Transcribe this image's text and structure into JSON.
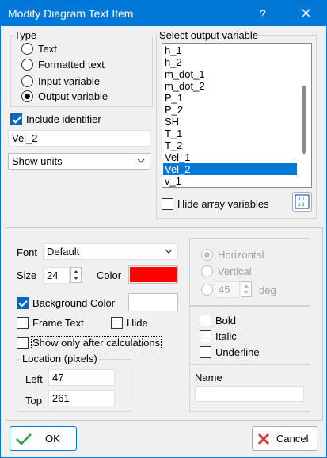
{
  "window": {
    "title": "Modify Diagram Text Item",
    "help_label": "?"
  },
  "type_group": {
    "label": "Type",
    "options": [
      {
        "label": "Text",
        "selected": false
      },
      {
        "label": "Formatted text",
        "selected": false
      },
      {
        "label": "Input variable",
        "selected": false
      },
      {
        "label": "Output variable",
        "selected": true
      }
    ]
  },
  "include_identifier": {
    "label": "Include identifier",
    "checked": true
  },
  "identifier_value": "Vel_2",
  "units_dropdown": {
    "value": "Show units"
  },
  "output_variable": {
    "label": "Select output variable",
    "items": [
      "h_1",
      "h_2",
      "m_dot_1",
      "m_dot_2",
      "P_1",
      "P_2",
      "SH",
      "T_1",
      "T_2",
      "Vel_1",
      "Vel_2",
      "v_1"
    ],
    "selected": "Vel_2"
  },
  "hide_array": {
    "label": "Hide array variables",
    "checked": false
  },
  "array_icon_text": "0 0\nb 3",
  "font": {
    "label": "Font",
    "value": "Default"
  },
  "size": {
    "label": "Size",
    "value": "24"
  },
  "color": {
    "label": "Color",
    "value": "#ff0000"
  },
  "background_color": {
    "label": "Background Color",
    "checked": true,
    "swatch": "#ffffff"
  },
  "frame_text": {
    "label": "Frame Text",
    "checked": false
  },
  "hide": {
    "label": "Hide",
    "checked": false
  },
  "show_after_calc": {
    "label": "Show only after calculations",
    "checked": false
  },
  "location": {
    "label": "Location (pixels)",
    "left_label": "Left",
    "left_value": "47",
    "top_label": "Top",
    "top_value": "261"
  },
  "orientation": {
    "horizontal": "Horizontal",
    "vertical": "Vertical",
    "angle": "45",
    "deg": "deg",
    "selected": "Horizontal",
    "enabled": false
  },
  "style": {
    "bold": {
      "label": "Bold",
      "checked": false
    },
    "italic": {
      "label": "Italic",
      "checked": false
    },
    "underline": {
      "label": "Underline",
      "checked": false
    }
  },
  "name": {
    "label": "Name",
    "value": ""
  },
  "ok_button": {
    "label": "OK"
  },
  "cancel_button": {
    "label": "Cancel"
  },
  "colors": {
    "accent": "#0078d7",
    "check_green": "#2e9b47",
    "cancel_red": "#d43d3d"
  }
}
